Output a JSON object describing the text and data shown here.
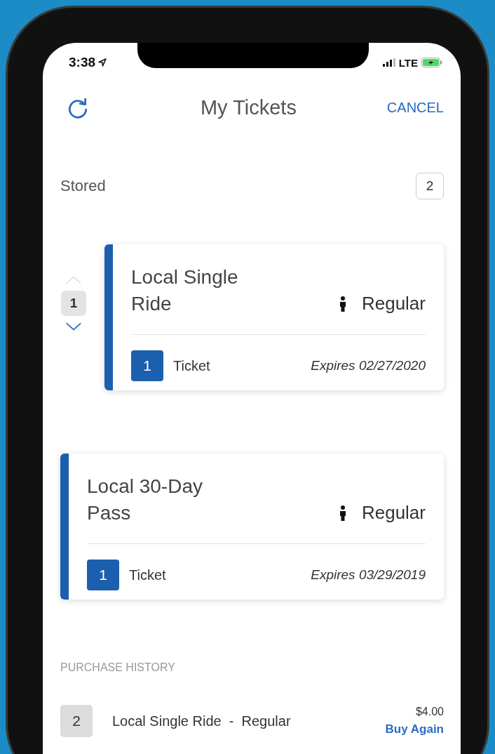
{
  "status_bar": {
    "time": "3:38",
    "network": "LTE"
  },
  "header": {
    "title": "My Tickets",
    "action": "CANCEL"
  },
  "stored": {
    "label": "Stored",
    "count": "2"
  },
  "tickets": [
    {
      "title": "Local Single Ride",
      "rider": "Regular",
      "quantity": "1",
      "unit": "Ticket",
      "expires": "Expires 02/27/2020",
      "stepper": {
        "value": "1",
        "up_disabled": true,
        "down_disabled": false
      }
    },
    {
      "title": "Local 30-Day Pass",
      "rider": "Regular",
      "quantity": "1",
      "unit": "Ticket",
      "expires": "Expires 03/29/2019"
    }
  ],
  "purchase_history": {
    "heading": "PURCHASE HISTORY",
    "rows": [
      {
        "count": "2",
        "description": "Local Single Ride  -  Regular",
        "price": "$4.00",
        "action": "Buy Again"
      }
    ]
  }
}
